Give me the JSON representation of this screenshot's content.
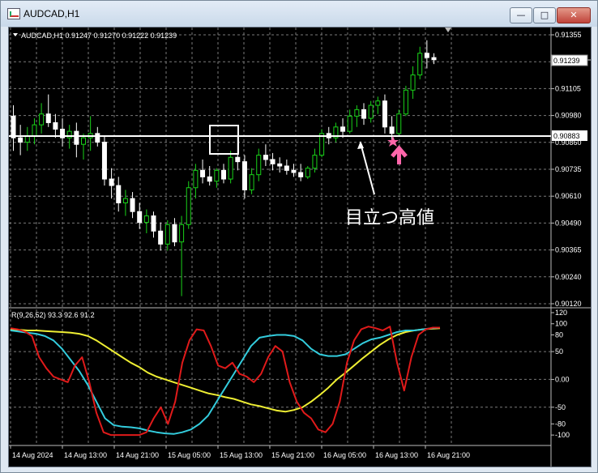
{
  "window": {
    "title": "AUDCAD,H1",
    "buttons": {
      "minimize": "—",
      "maximize": "□",
      "close": "✕"
    }
  },
  "chart_header": "AUDCAD,H1  0.91247 0.91270 0.91222 0.91239",
  "price_axis": {
    "ticks": [
      "0.91355",
      "0.91230",
      "0.91105",
      "0.90980",
      "0.90860",
      "0.90735",
      "0.90610",
      "0.90490",
      "0.90365",
      "0.90240",
      "0.90120"
    ],
    "current_price": "0.91239",
    "horizontal_line": "0.90883"
  },
  "annotation": "目立つ高値",
  "indicator": {
    "header": "R(9,26,52) 93.3 92.6 91.2",
    "ticks": [
      "120",
      "100",
      "80",
      "50",
      "0.00",
      "-50",
      "-80",
      "-100"
    ]
  },
  "time_axis": [
    "14 Aug 2024",
    "14 Aug 13:00",
    "14 Aug 21:00",
    "15 Aug 05:00",
    "15 Aug 13:00",
    "15 Aug 21:00",
    "16 Aug 05:00",
    "16 Aug 13:00",
    "16 Aug 21:00"
  ],
  "colors": {
    "background": "#000000",
    "grid": "#7a7a7a",
    "bull_candle": "#19d219",
    "bear_candle": "#ffffff",
    "line_short": "#e01a1a",
    "line_mid": "#33ccdd",
    "line_long": "#eeee33",
    "highlight_box": "#ffffff",
    "star": "#ff66aa",
    "arrow": "#ff66aa"
  },
  "chart_data": {
    "type": "candlestick",
    "symbol": "AUDCAD",
    "timeframe": "H1",
    "ohlc_last": {
      "open": 0.91247,
      "high": 0.9127,
      "low": 0.91222,
      "close": 0.91239
    },
    "candles": [
      [
        0.9098,
        0.9103,
        0.9082,
        0.9088
      ],
      [
        0.9088,
        0.9094,
        0.908,
        0.9086
      ],
      [
        0.9086,
        0.9093,
        0.9082,
        0.9089
      ],
      [
        0.9089,
        0.9097,
        0.9085,
        0.9094
      ],
      [
        0.9094,
        0.9104,
        0.909,
        0.9099
      ],
      [
        0.9099,
        0.9108,
        0.9093,
        0.9095
      ],
      [
        0.9095,
        0.9099,
        0.9088,
        0.9092
      ],
      [
        0.9092,
        0.9097,
        0.9084,
        0.9088
      ],
      [
        0.9088,
        0.9094,
        0.9083,
        0.9091
      ],
      [
        0.9091,
        0.9095,
        0.9079,
        0.9085
      ],
      [
        0.9085,
        0.909,
        0.9078,
        0.9088
      ],
      [
        0.9088,
        0.9098,
        0.9082,
        0.909
      ],
      [
        0.909,
        0.9093,
        0.9084,
        0.9086
      ],
      [
        0.9086,
        0.9089,
        0.9066,
        0.9069
      ],
      [
        0.9069,
        0.9074,
        0.906,
        0.9066
      ],
      [
        0.9066,
        0.907,
        0.9054,
        0.9058
      ],
      [
        0.9058,
        0.9064,
        0.9052,
        0.906
      ],
      [
        0.906,
        0.9063,
        0.9051,
        0.9054
      ],
      [
        0.9054,
        0.9058,
        0.9046,
        0.9049
      ],
      [
        0.9049,
        0.9055,
        0.9044,
        0.9052
      ],
      [
        0.9052,
        0.9054,
        0.9042,
        0.9045
      ],
      [
        0.9045,
        0.9049,
        0.9036,
        0.9039
      ],
      [
        0.9039,
        0.905,
        0.9036,
        0.9048
      ],
      [
        0.9048,
        0.9051,
        0.9038,
        0.904
      ],
      [
        0.904,
        0.9052,
        0.9015,
        0.9048
      ],
      [
        0.9048,
        0.9068,
        0.9046,
        0.9065
      ],
      [
        0.9065,
        0.9076,
        0.906,
        0.9073
      ],
      [
        0.9073,
        0.9078,
        0.9067,
        0.907
      ],
      [
        0.907,
        0.9075,
        0.9066,
        0.9068
      ],
      [
        0.9068,
        0.9074,
        0.9065,
        0.9073
      ],
      [
        0.9073,
        0.9076,
        0.9067,
        0.9069
      ],
      [
        0.9069,
        0.9082,
        0.9067,
        0.9079
      ],
      [
        0.9079,
        0.9089,
        0.9073,
        0.9077
      ],
      [
        0.9077,
        0.908,
        0.906,
        0.9064
      ],
      [
        0.9064,
        0.9074,
        0.9062,
        0.9071
      ],
      [
        0.9071,
        0.9083,
        0.9068,
        0.908
      ],
      [
        0.908,
        0.9085,
        0.9075,
        0.9078
      ],
      [
        0.9078,
        0.9081,
        0.9073,
        0.9076
      ],
      [
        0.9076,
        0.9079,
        0.9072,
        0.9075
      ],
      [
        0.9075,
        0.9078,
        0.9071,
        0.9073
      ],
      [
        0.9073,
        0.9076,
        0.907,
        0.9072
      ],
      [
        0.9072,
        0.9076,
        0.9068,
        0.907
      ],
      [
        0.907,
        0.9075,
        0.9069,
        0.9074
      ],
      [
        0.9074,
        0.9083,
        0.9072,
        0.908
      ],
      [
        0.908,
        0.9092,
        0.9079,
        0.909
      ],
      [
        0.909,
        0.9093,
        0.9085,
        0.9088
      ],
      [
        0.9088,
        0.9095,
        0.9086,
        0.9093
      ],
      [
        0.9093,
        0.9097,
        0.9088,
        0.9091
      ],
      [
        0.9091,
        0.9101,
        0.909,
        0.9098
      ],
      [
        0.9098,
        0.9103,
        0.9093,
        0.9101
      ],
      [
        0.9101,
        0.9104,
        0.9094,
        0.9097
      ],
      [
        0.9097,
        0.9105,
        0.9095,
        0.9103
      ],
      [
        0.9103,
        0.9107,
        0.9099,
        0.9105
      ],
      [
        0.9105,
        0.9108,
        0.909,
        0.9093
      ],
      [
        0.9093,
        0.9098,
        0.9086,
        0.909
      ],
      [
        0.909,
        0.9101,
        0.9089,
        0.9099
      ],
      [
        0.9099,
        0.9112,
        0.9098,
        0.911
      ],
      [
        0.911,
        0.9121,
        0.9106,
        0.9117
      ],
      [
        0.9117,
        0.913,
        0.9115,
        0.9127
      ],
      [
        0.9127,
        0.9133,
        0.912,
        0.9125
      ],
      [
        0.9125,
        0.9127,
        0.9122,
        0.9124
      ]
    ]
  },
  "indicator_data": {
    "ylim": [
      -110,
      120
    ],
    "red": [
      92,
      90,
      86,
      78,
      40,
      20,
      5,
      0,
      -5,
      25,
      40,
      -5,
      -60,
      -95,
      -100,
      -100,
      -100,
      -100,
      -100,
      -95,
      -70,
      -50,
      -80,
      -40,
      30,
      70,
      90,
      88,
      60,
      25,
      20,
      30,
      10,
      5,
      -5,
      10,
      40,
      60,
      50,
      -5,
      -40,
      -60,
      -70,
      -90,
      -95,
      -80,
      -40,
      30,
      70,
      90,
      95,
      92,
      88,
      95,
      30,
      -20,
      40,
      80,
      90,
      93,
      93
    ],
    "cyan": [
      88,
      86,
      84,
      82,
      78,
      70,
      55,
      35,
      15,
      -10,
      -40,
      -70,
      -82,
      -85,
      -86,
      -88,
      -92,
      -95,
      -97,
      -98,
      -95,
      -90,
      -80,
      -65,
      -40,
      -15,
      10,
      35,
      60,
      75,
      78,
      80,
      80,
      78,
      70,
      55,
      45,
      42,
      42,
      45,
      55,
      65,
      72,
      75,
      80,
      85,
      88,
      88,
      90,
      92,
      93
    ],
    "yellow": [
      90,
      89,
      88,
      88,
      87,
      86,
      85,
      84,
      82,
      78,
      70,
      60,
      50,
      40,
      30,
      22,
      12,
      5,
      0,
      -5,
      -10,
      -15,
      -20,
      -25,
      -28,
      -32,
      -35,
      -40,
      -45,
      -48,
      -52,
      -56,
      -58,
      -55,
      -50,
      -40,
      -28,
      -15,
      0,
      12,
      25,
      38,
      50,
      62,
      72,
      80,
      85,
      88,
      90,
      91,
      92
    ]
  }
}
